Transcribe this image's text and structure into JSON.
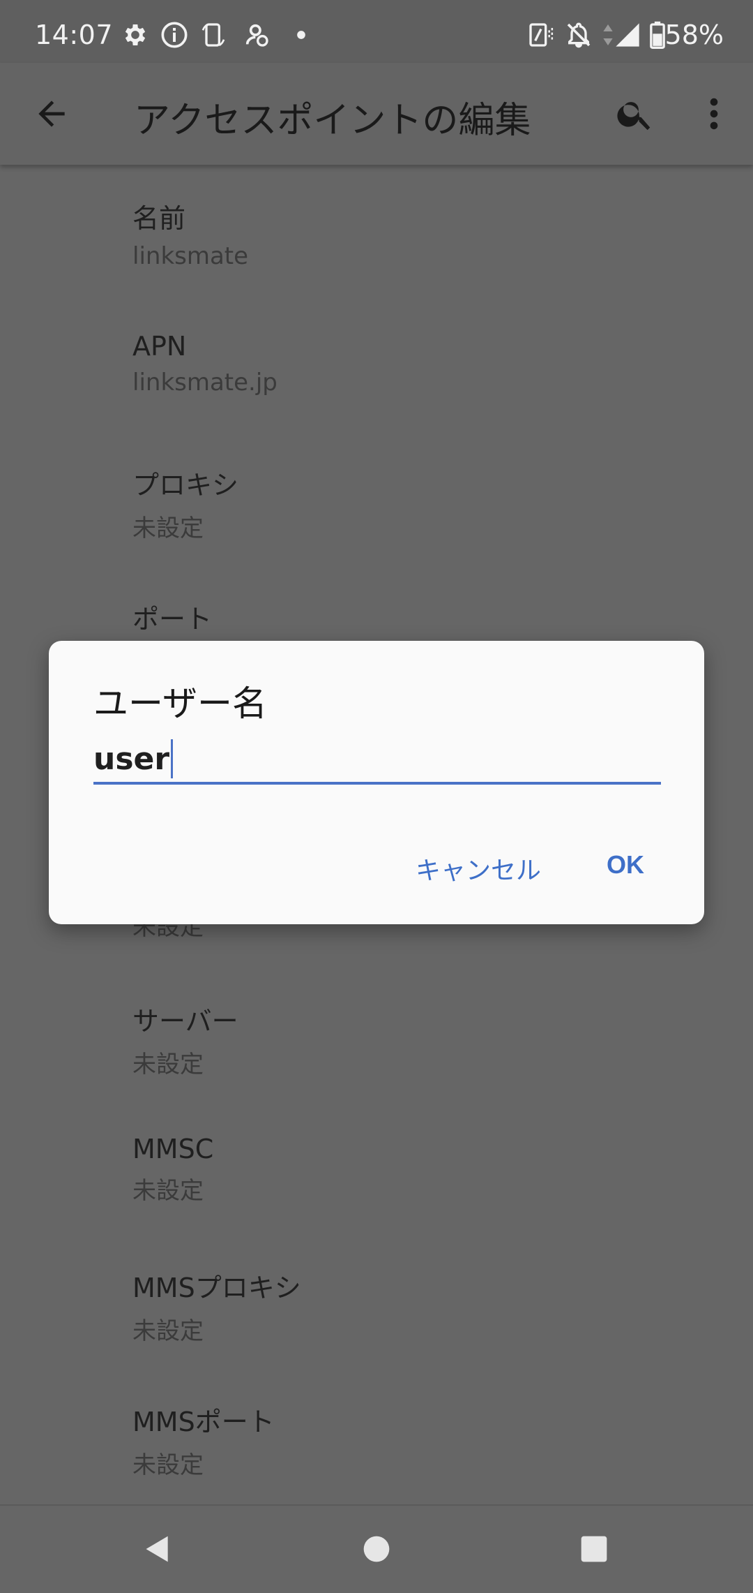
{
  "status_bar": {
    "time": "14:07",
    "battery": "58%",
    "icons": [
      "gear-icon",
      "info-icon",
      "screen-rotate-icon",
      "account-sync-icon",
      "dot-icon",
      "nfc-icon",
      "notifications-off-icon",
      "signal-icon",
      "battery-icon"
    ]
  },
  "app_bar": {
    "title": "アクセスポイントの編集",
    "back_icon": "arrow-back-icon",
    "search_icon": "search-icon",
    "more_icon": "more-vert-icon"
  },
  "list": [
    {
      "title": "名前",
      "summary": "linksmate"
    },
    {
      "title": "APN",
      "summary": "linksmate.jp"
    },
    {
      "title": "プロキシ",
      "summary": "未設定"
    },
    {
      "title": "ポート",
      "summary": ""
    },
    {
      "title": "",
      "summary": "未設定"
    },
    {
      "title": "サーバー",
      "summary": "未設定"
    },
    {
      "title": "MMSC",
      "summary": "未設定"
    },
    {
      "title": "MMSプロキシ",
      "summary": "未設定"
    },
    {
      "title": "MMSポート",
      "summary": "未設定"
    }
  ],
  "dialog": {
    "title": "ユーザー名",
    "input_value": "user",
    "cancel_label": "キャンセル",
    "ok_label": "OK"
  },
  "colors": {
    "accent": "#3e6fc8",
    "scrim_background": "#666666",
    "dialog_background": "#fafafa"
  }
}
